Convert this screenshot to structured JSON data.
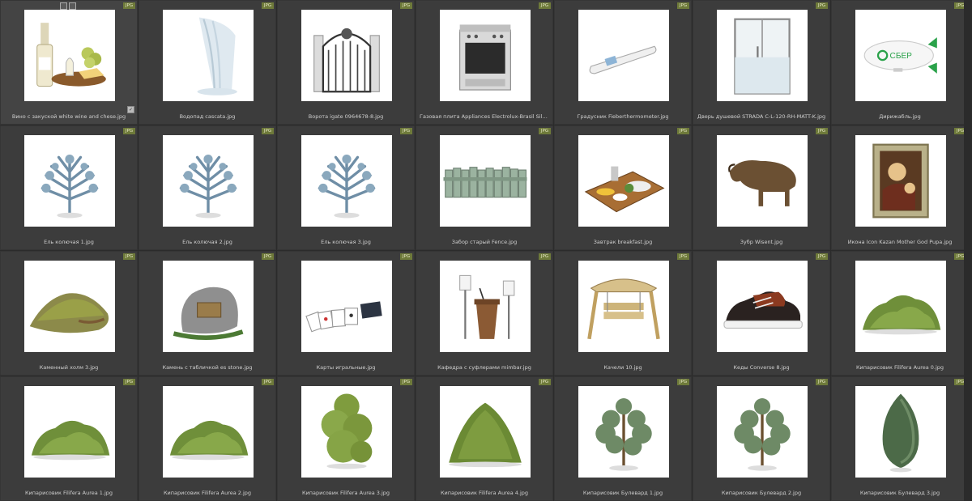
{
  "badge_label": "JPG",
  "items": [
    {
      "caption": "Вино с закуской white wine and chese.jpg",
      "icon": "wine-cheese-icon"
    },
    {
      "caption": "Водопад cascata.jpg",
      "icon": "waterfall-icon"
    },
    {
      "caption": "Ворота igate 0964678-8.jpg",
      "icon": "gate-icon"
    },
    {
      "caption": "Газовая плита Appliances Electrolux-Brasil Silver.jpg",
      "icon": "gas-stove-icon"
    },
    {
      "caption": "Градусник Fieberthermometer.jpg",
      "icon": "thermometer-icon"
    },
    {
      "caption": "Дверь душевой STRADA C-L-120-RH-MATT-K.jpg",
      "icon": "shower-door-icon"
    },
    {
      "caption": "Дирижабль.jpg",
      "icon": "airship-icon",
      "airship_text": "СБЕР"
    },
    {
      "caption": "Ель колючая 1.jpg",
      "icon": "spruce-icon"
    },
    {
      "caption": "Ель колючая 2.jpg",
      "icon": "spruce-icon"
    },
    {
      "caption": "Ель колючая 3.jpg",
      "icon": "spruce-icon"
    },
    {
      "caption": "Забор старый Fence.jpg",
      "icon": "fence-icon"
    },
    {
      "caption": "Завтрак breakfast.jpg",
      "icon": "breakfast-icon"
    },
    {
      "caption": "Зубр Wisent.jpg",
      "icon": "bison-icon"
    },
    {
      "caption": "Икона Icon Kazan Mother God Pupa.jpg",
      "icon": "icon-painting-icon"
    },
    {
      "caption": "Каменный холм 3.jpg",
      "icon": "rock-hill-icon"
    },
    {
      "caption": "Камень с табличкой es stone.jpg",
      "icon": "stone-plaque-icon"
    },
    {
      "caption": "Карты игральные.jpg",
      "icon": "playing-cards-icon"
    },
    {
      "caption": "Кафедра с суфлерами mimbar.jpg",
      "icon": "lectern-icon"
    },
    {
      "caption": "Качели 10.jpg",
      "icon": "swing-icon"
    },
    {
      "caption": "Кеды Converse 8.jpg",
      "icon": "sneaker-icon"
    },
    {
      "caption": "Кипарисовик Filifera Aurea 0.jpg",
      "icon": "shrub-low-icon"
    },
    {
      "caption": "Кипарисовик Filifera Aurea 1.jpg",
      "icon": "shrub-low-icon"
    },
    {
      "caption": "Кипарисовик Filifera Aurea 2.jpg",
      "icon": "shrub-low-icon"
    },
    {
      "caption": "Кипарисовик Filifera Aurea 3.jpg",
      "icon": "shrub-tall-icon"
    },
    {
      "caption": "Кипарисовик Filifera Aurea 4.jpg",
      "icon": "shrub-mound-icon"
    },
    {
      "caption": "Кипарисовик Булевард 1.jpg",
      "icon": "tree-icon"
    },
    {
      "caption": "Кипарисовик Булевард 2.jpg",
      "icon": "tree-icon"
    },
    {
      "caption": "Кипарисовик Булевард 3.jpg",
      "icon": "cypress-icon"
    }
  ]
}
